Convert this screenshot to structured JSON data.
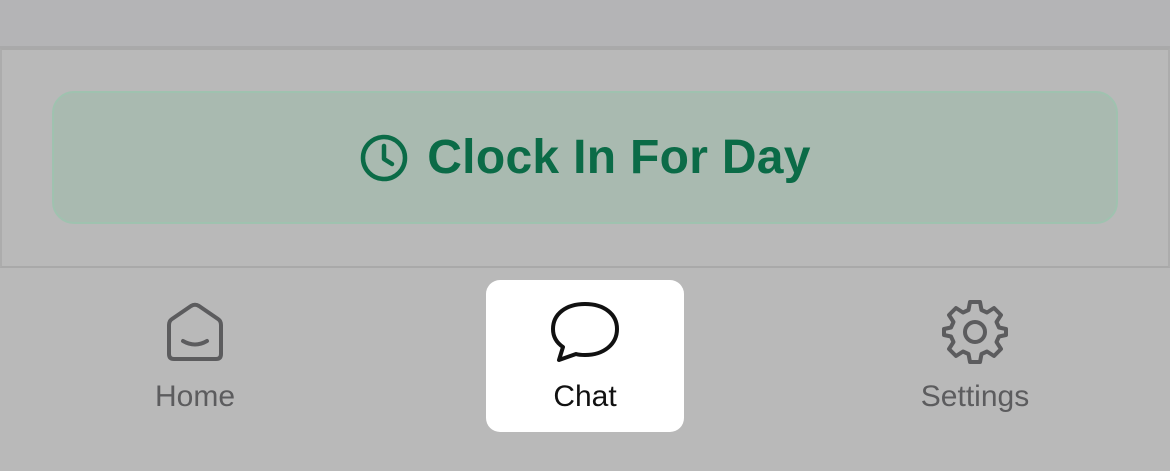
{
  "clock": {
    "button_label": "Clock In For Day",
    "icon": "clock-icon",
    "color": "#0b6b47"
  },
  "tabbar": {
    "tabs": [
      {
        "label": "Home",
        "icon": "home-icon",
        "active": false
      },
      {
        "label": "Chat",
        "icon": "chat-bubble-icon",
        "active": true
      },
      {
        "label": "Settings",
        "icon": "gear-icon",
        "active": false
      }
    ]
  }
}
